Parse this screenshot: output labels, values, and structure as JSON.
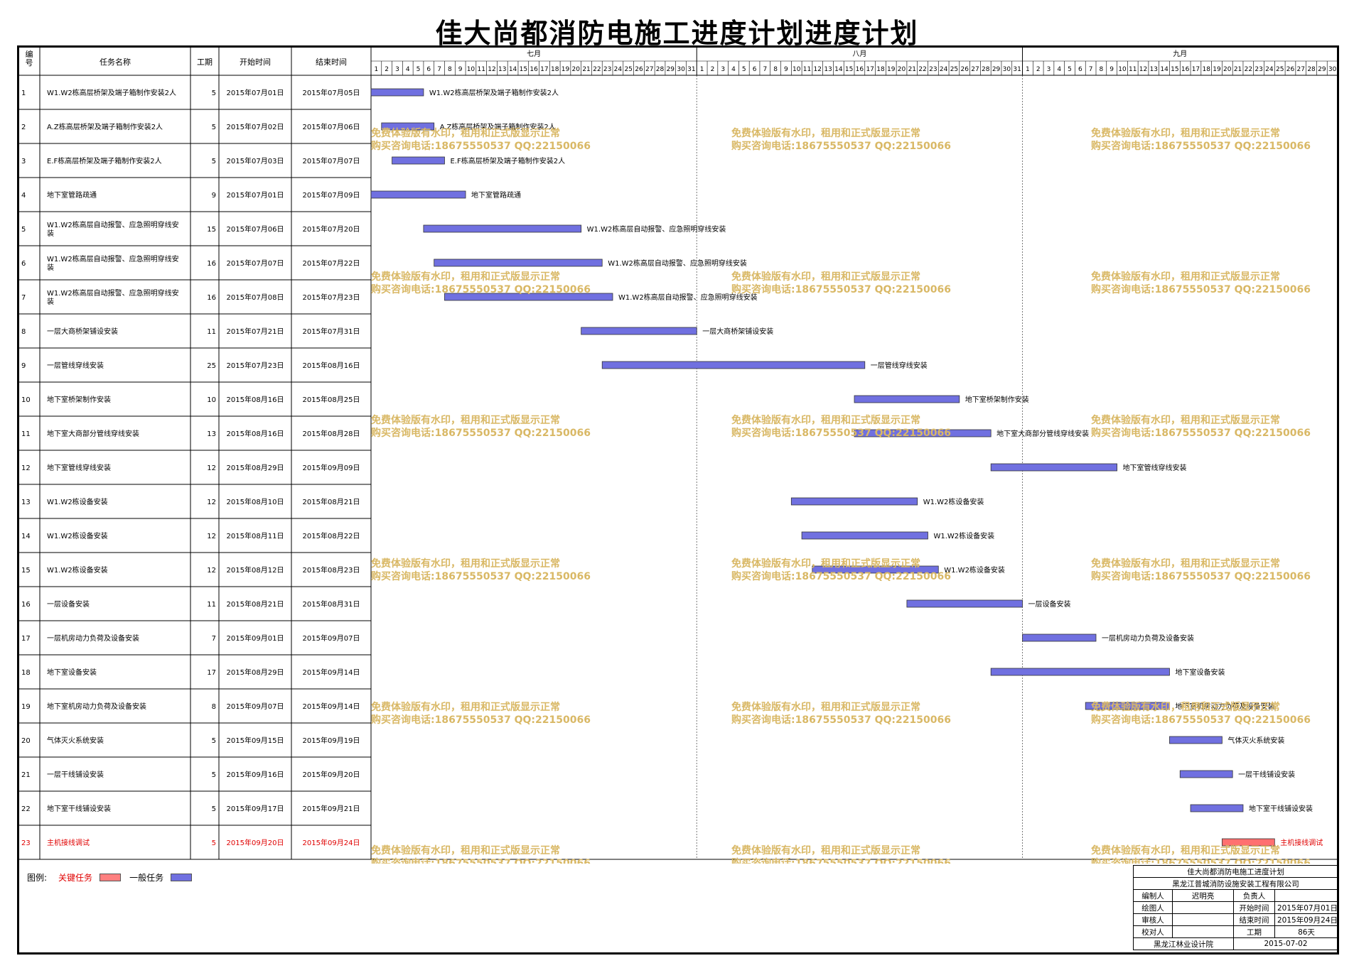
{
  "title": "佳大尚都消防电施工进度计划进度计划",
  "columns": {
    "id": "编号",
    "name": "任务名称",
    "duration": "工期",
    "start": "开始时间",
    "end": "结束时间"
  },
  "months": [
    {
      "label": "七月",
      "days": 31
    },
    {
      "label": "八月",
      "days": 31
    },
    {
      "label": "九月",
      "days": 30
    }
  ],
  "watermark": {
    "line1": "免费体验版有水印，租用和正式版显示正常",
    "line2": "购买咨询电话:18675550537 QQ:22150066"
  },
  "colors": {
    "normal_bar": "#7070e0",
    "critical_bar": "#ff7070",
    "critical_text": "#e00000",
    "watermark": "#d9b865"
  },
  "chart_data": {
    "type": "gantt",
    "timeline_start": "2015-07-01",
    "timeline_end": "2015-09-30",
    "tasks": [
      {
        "id": "1",
        "name": "W1.W2栋高层桥架及端子箱制作安装2人",
        "duration": "5",
        "start": "2015年07月01日",
        "end": "2015年07月05日",
        "s": "2015-07-01",
        "e": "2015-07-05",
        "critical": false
      },
      {
        "id": "2",
        "name": "A.Z栋高层桥架及端子箱制作安装2人",
        "duration": "5",
        "start": "2015年07月02日",
        "end": "2015年07月06日",
        "s": "2015-07-02",
        "e": "2015-07-06",
        "critical": false
      },
      {
        "id": "3",
        "name": "E.F栋高层桥架及端子箱制作安装2人",
        "duration": "5",
        "start": "2015年07月03日",
        "end": "2015年07月07日",
        "s": "2015-07-03",
        "e": "2015-07-07",
        "critical": false
      },
      {
        "id": "4",
        "name": "地下室管路疏通",
        "duration": "9",
        "start": "2015年07月01日",
        "end": "2015年07月09日",
        "s": "2015-07-01",
        "e": "2015-07-09",
        "critical": false
      },
      {
        "id": "5",
        "name": "W1.W2栋高层自动报警、应急照明穿线安装",
        "duration": "15",
        "start": "2015年07月06日",
        "end": "2015年07月20日",
        "s": "2015-07-06",
        "e": "2015-07-20",
        "critical": false
      },
      {
        "id": "6",
        "name": "W1.W2栋高层自动报警、应急照明穿线安装",
        "duration": "16",
        "start": "2015年07月07日",
        "end": "2015年07月22日",
        "s": "2015-07-07",
        "e": "2015-07-22",
        "critical": false
      },
      {
        "id": "7",
        "name": "W1.W2栋高层自动报警、应急照明穿线安装",
        "duration": "16",
        "start": "2015年07月08日",
        "end": "2015年07月23日",
        "s": "2015-07-08",
        "e": "2015-07-23",
        "critical": false
      },
      {
        "id": "8",
        "name": "一层大商桥架铺设安装",
        "duration": "11",
        "start": "2015年07月21日",
        "end": "2015年07月31日",
        "s": "2015-07-21",
        "e": "2015-07-31",
        "critical": false
      },
      {
        "id": "9",
        "name": "一层管线穿线安装",
        "duration": "25",
        "start": "2015年07月23日",
        "end": "2015年08月16日",
        "s": "2015-07-23",
        "e": "2015-08-16",
        "critical": false
      },
      {
        "id": "10",
        "name": "地下室桥架制作安装",
        "duration": "10",
        "start": "2015年08月16日",
        "end": "2015年08月25日",
        "s": "2015-08-16",
        "e": "2015-08-25",
        "critical": false
      },
      {
        "id": "11",
        "name": "地下室大商部分管线穿线安装",
        "duration": "13",
        "start": "2015年08月16日",
        "end": "2015年08月28日",
        "s": "2015-08-16",
        "e": "2015-08-28",
        "critical": false
      },
      {
        "id": "12",
        "name": "地下室管线穿线安装",
        "duration": "12",
        "start": "2015年08月29日",
        "end": "2015年09月09日",
        "s": "2015-08-29",
        "e": "2015-09-09",
        "critical": false
      },
      {
        "id": "13",
        "name": "W1.W2栋设备安装",
        "duration": "12",
        "start": "2015年08月10日",
        "end": "2015年08月21日",
        "s": "2015-08-10",
        "e": "2015-08-21",
        "critical": false
      },
      {
        "id": "14",
        "name": "W1.W2栋设备安装",
        "duration": "12",
        "start": "2015年08月11日",
        "end": "2015年08月22日",
        "s": "2015-08-11",
        "e": "2015-08-22",
        "critical": false
      },
      {
        "id": "15",
        "name": "W1.W2栋设备安装",
        "duration": "12",
        "start": "2015年08月12日",
        "end": "2015年08月23日",
        "s": "2015-08-12",
        "e": "2015-08-23",
        "critical": false
      },
      {
        "id": "16",
        "name": "一层设备安装",
        "duration": "11",
        "start": "2015年08月21日",
        "end": "2015年08月31日",
        "s": "2015-08-21",
        "e": "2015-08-31",
        "critical": false
      },
      {
        "id": "17",
        "name": "一层机房动力负荷及设备安装",
        "duration": "7",
        "start": "2015年09月01日",
        "end": "2015年09月07日",
        "s": "2015-09-01",
        "e": "2015-09-07",
        "critical": false
      },
      {
        "id": "18",
        "name": "地下室设备安装",
        "duration": "17",
        "start": "2015年08月29日",
        "end": "2015年09月14日",
        "s": "2015-08-29",
        "e": "2015-09-14",
        "critical": false
      },
      {
        "id": "19",
        "name": "地下室机房动力负荷及设备安装",
        "duration": "8",
        "start": "2015年09月07日",
        "end": "2015年09月14日",
        "s": "2015-09-07",
        "e": "2015-09-14",
        "critical": false
      },
      {
        "id": "20",
        "name": "气体灭火系统安装",
        "duration": "5",
        "start": "2015年09月15日",
        "end": "2015年09月19日",
        "s": "2015-09-15",
        "e": "2015-09-19",
        "critical": false
      },
      {
        "id": "21",
        "name": "一层干线铺设安装",
        "duration": "5",
        "start": "2015年09月16日",
        "end": "2015年09月20日",
        "s": "2015-09-16",
        "e": "2015-09-20",
        "critical": false
      },
      {
        "id": "22",
        "name": "地下室干线铺设安装",
        "duration": "5",
        "start": "2015年09月17日",
        "end": "2015年09月21日",
        "s": "2015-09-17",
        "e": "2015-09-21",
        "critical": false
      },
      {
        "id": "23",
        "name": "主机接线调试",
        "duration": "5",
        "start": "2015年09月20日",
        "end": "2015年09月24日",
        "s": "2015-09-20",
        "e": "2015-09-24",
        "critical": true
      }
    ]
  },
  "legend": {
    "label": "图例:",
    "critical": "关键任务",
    "normal": "一般任务"
  },
  "titleblock": {
    "project": "佳大尚都消防电施工进度计划",
    "company": "黑龙江普城消防设施安装工程有限公司",
    "compiler_label": "编制人",
    "compiler": "迟明亮",
    "leader_label": "负责人",
    "leader": "",
    "drawer_label": "绘图人",
    "drawer": "",
    "start_label": "开始时间",
    "start": "2015年07月01日",
    "reviewer_label": "审核人",
    "reviewer": "",
    "end_label": "结束时间",
    "end": "2015年09月24日",
    "checker_label": "校对人",
    "checker": "",
    "duration_label": "工期",
    "duration": "86天",
    "institute": "黑龙江林业设计院",
    "date": "2015-07-02"
  }
}
